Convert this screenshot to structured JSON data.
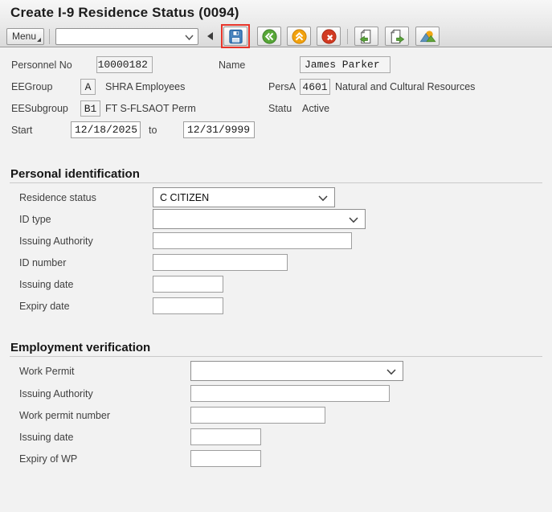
{
  "window": {
    "title": "Create I-9 Residence Status (0094)"
  },
  "toolbar": {
    "menu_label": "Menu",
    "command_value": "",
    "icons": [
      "save-icon",
      "back-icon",
      "exit-icon",
      "cancel-icon",
      "previous-record-icon",
      "next-record-icon",
      "overview-icon"
    ]
  },
  "colors": {
    "save_highlight_red": "#e8352a",
    "save_icon_blue": "#3d7ab8",
    "back_icon_green": "#58a738",
    "exit_icon_amber": "#f2a20e",
    "cancel_icon_red": "#d23a22",
    "record_arrow_green": "#5aa33a",
    "overview_mountain_blue": "#5e93bd",
    "overview_mountain_green": "#61a839",
    "overview_sun_orange": "#f0a613",
    "background": "#f2f2f2"
  },
  "header_fields": {
    "personnel_no": {
      "label": "Personnel No",
      "value": "10000182"
    },
    "name": {
      "label": "Name",
      "value": "James Parker"
    },
    "ee_group": {
      "label": "EEGroup",
      "code": "A",
      "text": "SHRA Employees"
    },
    "pers_area": {
      "label": "PersA",
      "code": "4601",
      "text": "Natural and Cultural Resources"
    },
    "ee_subgroup": {
      "label": "EESubgroup",
      "code": "B1",
      "text": "FT S-FLSAOT Perm"
    },
    "status": {
      "label": "Statu",
      "value": "Active"
    },
    "validity": {
      "label": "Start",
      "from": "12/18/2025",
      "to_label": "to",
      "to": "12/31/9999"
    }
  },
  "personal_identification": {
    "title": "Personal identification",
    "residence_status": {
      "label": "Residence status",
      "value": "C CITIZEN"
    },
    "id_type": {
      "label": "ID type",
      "value": ""
    },
    "issuing_authority": {
      "label": "Issuing Authority",
      "value": ""
    },
    "id_number": {
      "label": "ID number",
      "value": ""
    },
    "issuing_date": {
      "label": "Issuing date",
      "value": ""
    },
    "expiry_date": {
      "label": "Expiry date",
      "value": ""
    }
  },
  "employment_verification": {
    "title": "Employment verification",
    "work_permit": {
      "label": "Work Permit",
      "value": ""
    },
    "issuing_authority": {
      "label": "Issuing Authority",
      "value": ""
    },
    "work_permit_number": {
      "label": "Work permit number",
      "value": ""
    },
    "issuing_date": {
      "label": "Issuing date",
      "value": ""
    },
    "expiry_of_wp": {
      "label": "Expiry of WP",
      "value": ""
    }
  }
}
